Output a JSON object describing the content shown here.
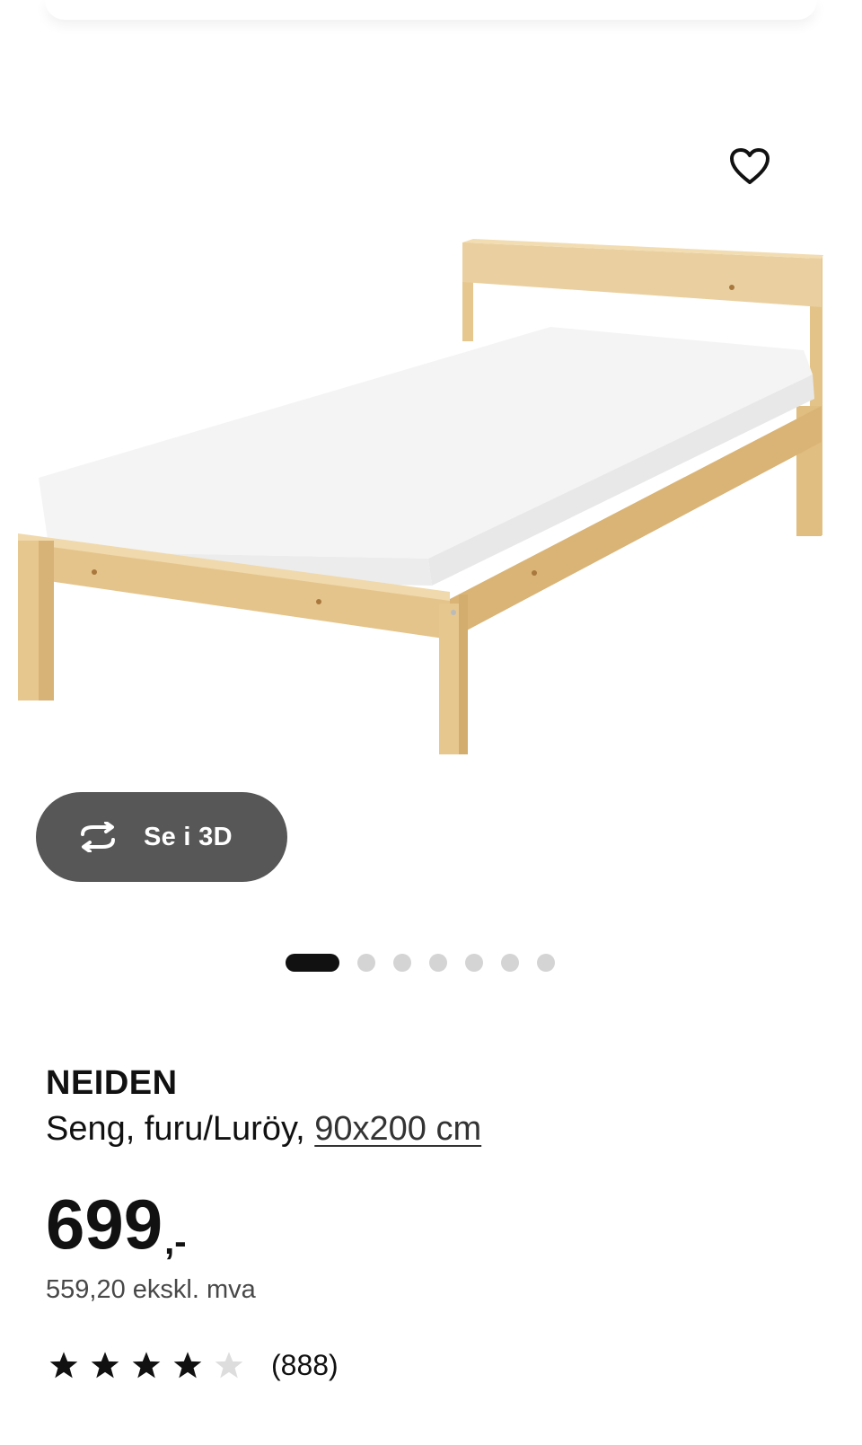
{
  "gallery": {
    "view3d_label": "Se i 3D",
    "image_count": 7,
    "active_index": 0
  },
  "product": {
    "name": "NEIDEN",
    "description": "Seng, furu/Luröy,",
    "size": "90x200 cm",
    "price": "699",
    "price_suffix": ",-",
    "price_ex_vat": "559,20 ekskl. mva"
  },
  "rating": {
    "value": 4,
    "max": 5,
    "count": "(888)"
  },
  "icons": {
    "favorite": "heart-outline-icon",
    "view3d": "rotate-3d-icon",
    "star_filled": "star-icon",
    "star_empty": "star-empty-icon"
  },
  "colors": {
    "pill_bg": "#575757",
    "text": "#111111",
    "dot_inactive": "#d4d4d4",
    "star_empty": "#dddddd"
  }
}
